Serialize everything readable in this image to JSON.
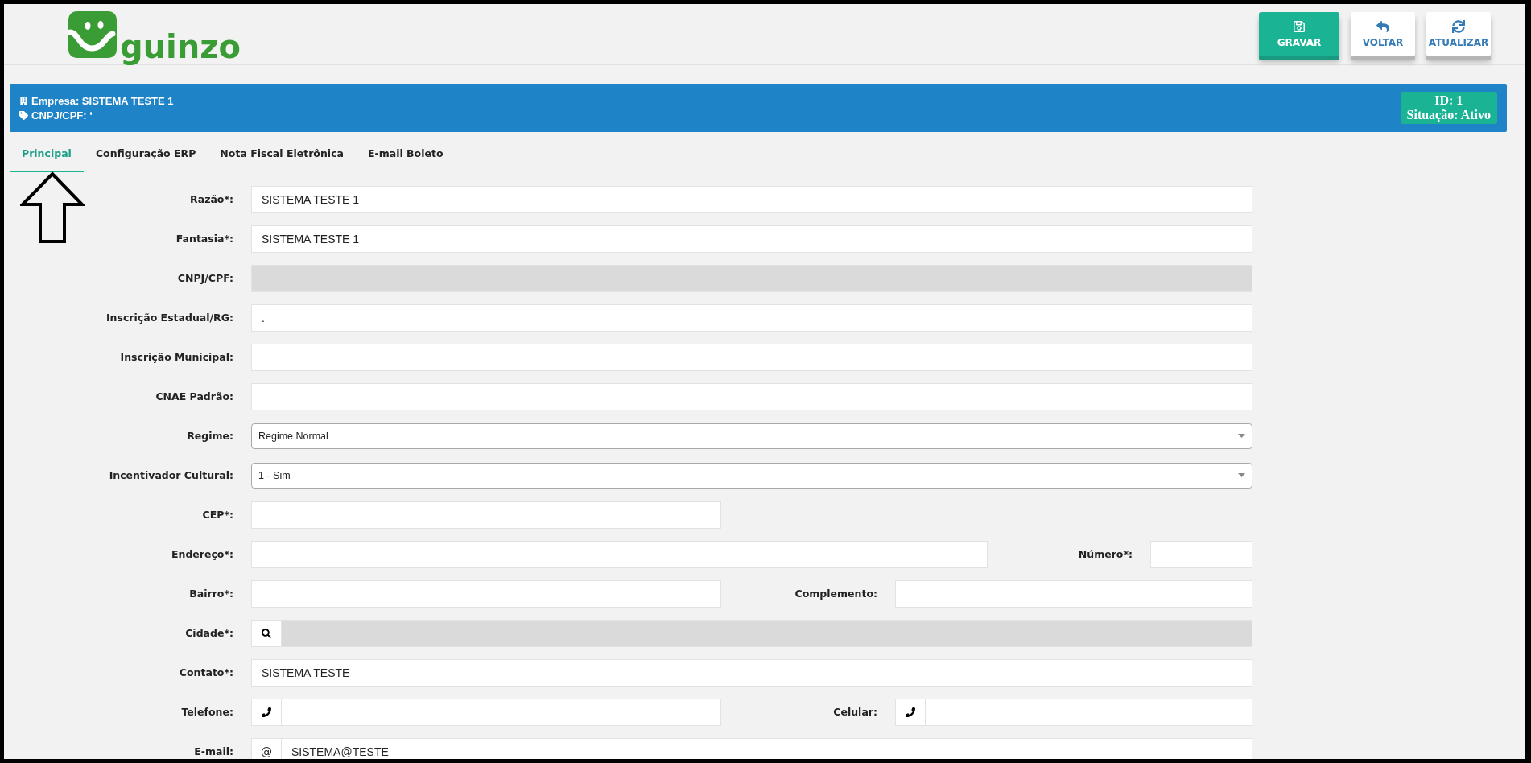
{
  "logo": {
    "text": "guinzo"
  },
  "toolbar": [
    {
      "label": "GRAVAR",
      "kind": "primary"
    },
    {
      "label": "VOLTAR",
      "kind": "default"
    },
    {
      "label": "ATUALIZAR",
      "kind": "default"
    }
  ],
  "company_bar": {
    "company": "Empresa: SISTEMA TESTE 1",
    "document": "CNPJ/CPF: ‘",
    "id": "ID: 1",
    "status": "Situação: Ativo"
  },
  "tabs": [
    {
      "label": "Principal",
      "selected": true
    },
    {
      "label": "Configuração ERP",
      "selected": false
    },
    {
      "label": "Nota Fiscal Eletrônica",
      "selected": false
    },
    {
      "label": "E-mail Boleto",
      "selected": false
    }
  ],
  "form_rows": [
    {
      "kind": "full",
      "fields": [
        {
          "label": "Razão*:",
          "kind": "text",
          "value": "SISTEMA TESTE 1",
          "disabled": false
        }
      ]
    },
    {
      "kind": "full",
      "fields": [
        {
          "label": "Fantasia*:",
          "kind": "text",
          "value": "SISTEMA TESTE 1",
          "disabled": false
        }
      ]
    },
    {
      "kind": "full",
      "fields": [
        {
          "label": "CNPJ/CPF:",
          "kind": "text",
          "disabled": true
        }
      ]
    },
    {
      "kind": "full",
      "fields": [
        {
          "label": "Inscrição Estadual/RG:",
          "kind": "text",
          "value": ".",
          "disabled": false
        }
      ]
    },
    {
      "kind": "full",
      "fields": [
        {
          "label": "Inscrição Municipal:",
          "kind": "text",
          "disabled": false
        }
      ]
    },
    {
      "kind": "full",
      "fields": [
        {
          "label": "CNAE Padrão:",
          "kind": "text",
          "disabled": false
        }
      ]
    },
    {
      "kind": "full",
      "fields": [
        {
          "label": "Regime:",
          "kind": "select",
          "value": "Regime Normal",
          "disabled": false
        }
      ]
    },
    {
      "kind": "full",
      "fields": [
        {
          "label": "Incentivador Cultural:",
          "kind": "select",
          "value": "1 - Sim",
          "disabled": false
        }
      ]
    },
    {
      "kind": "short",
      "fields": [
        {
          "label": "CEP*:",
          "kind": "text",
          "disabled": false
        }
      ]
    },
    {
      "kind": "wide_narrow",
      "fields": [
        {
          "label": "Endereço*:",
          "kind": "text",
          "disabled": false
        },
        {
          "label": "Número*:",
          "kind": "text",
          "disabled": false
        }
      ]
    },
    {
      "kind": "halves",
      "fields": [
        {
          "label": "Bairro*:",
          "kind": "text",
          "disabled": false
        },
        {
          "label": "Complemento:",
          "kind": "text",
          "disabled": false
        }
      ]
    },
    {
      "kind": "full",
      "fields": [
        {
          "label": "Cidade*:",
          "kind": "search",
          "disabled": true
        }
      ]
    },
    {
      "kind": "full",
      "fields": [
        {
          "label": "Contato*:",
          "kind": "text",
          "value": "SISTEMA TESTE",
          "disabled": false
        }
      ]
    },
    {
      "kind": "halves",
      "fields": [
        {
          "label": "Telefone:",
          "kind": "phone",
          "disabled": false
        },
        {
          "label": "Celular:",
          "kind": "phone",
          "disabled": false
        }
      ]
    },
    {
      "kind": "full",
      "fields": [
        {
          "label": "E-mail:",
          "kind": "prefix",
          "prefix": "@",
          "value": "SISTEMA@TESTE",
          "disabled": false
        }
      ]
    }
  ]
}
